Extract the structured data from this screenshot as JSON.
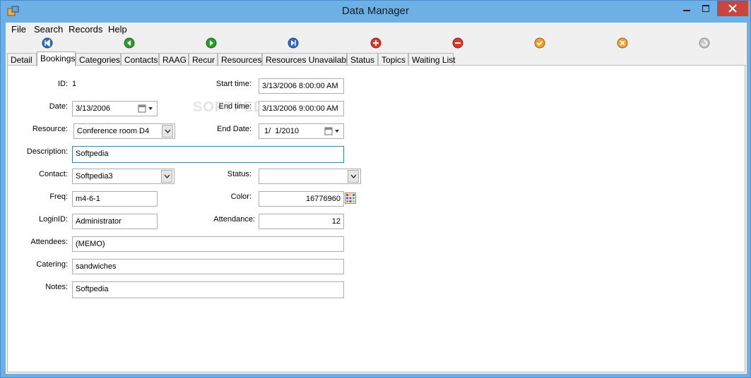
{
  "window": {
    "title": "Data Manager"
  },
  "menu": [
    "File",
    "Search",
    "Records",
    "Help"
  ],
  "toolbar": {
    "buttons": [
      {
        "name": "first-record-icon",
        "color": "#2d6fc4"
      },
      {
        "name": "previous-record-icon",
        "color": "#2f9a2f"
      },
      {
        "name": "next-record-icon",
        "color": "#2f9a2f"
      },
      {
        "name": "last-record-icon",
        "color": "#2d6fc4"
      },
      {
        "name": "add-record-icon",
        "color": "#d83a2a"
      },
      {
        "name": "delete-record-icon",
        "color": "#d83a2a"
      },
      {
        "name": "save-record-icon",
        "color": "#f0a030"
      },
      {
        "name": "cancel-edit-icon",
        "color": "#f0a030"
      },
      {
        "name": "refresh-icon",
        "color": "#b8b8b8"
      }
    ]
  },
  "tabs": [
    "Detail",
    "Bookings",
    "Categories",
    "Contacts",
    "RAAG",
    "Recur",
    "Resources",
    "Resources Unavailable",
    "Status",
    "Topics",
    "Waiting List"
  ],
  "active_tab": "Bookings",
  "form": {
    "id": {
      "label": "ID:",
      "value": "1"
    },
    "start_time": {
      "label": "Start time:",
      "value": "3/13/2006 8:00:00 AM"
    },
    "date": {
      "label": "Date:",
      "value": "3/13/2006"
    },
    "end_time": {
      "label": "End time:",
      "value": "3/13/2006 9:00:00 AM"
    },
    "resource": {
      "label": "Resource:",
      "value": "Conference room D4"
    },
    "end_date": {
      "label": "End Date:",
      "value": "1/  1/2010"
    },
    "description": {
      "label": "Description:",
      "value": "Softpedia"
    },
    "contact": {
      "label": "Contact:",
      "value": "Softpedia3"
    },
    "status": {
      "label": "Status:",
      "value": ""
    },
    "freq": {
      "label": "Freq:",
      "value": "m4-6-1"
    },
    "color": {
      "label": "Color:",
      "value": "16776960"
    },
    "login_id": {
      "label": "LoginID:",
      "value": "Administrator"
    },
    "attendance": {
      "label": "Attendance:",
      "value": "12"
    },
    "attendees": {
      "label": "Attendees:",
      "value": "(MEMO)"
    },
    "catering": {
      "label": "Catering:",
      "value": "sandwiches"
    },
    "notes": {
      "label": "Notes:",
      "value": "Softpedia"
    }
  },
  "watermark": "SOFTPEDIA"
}
